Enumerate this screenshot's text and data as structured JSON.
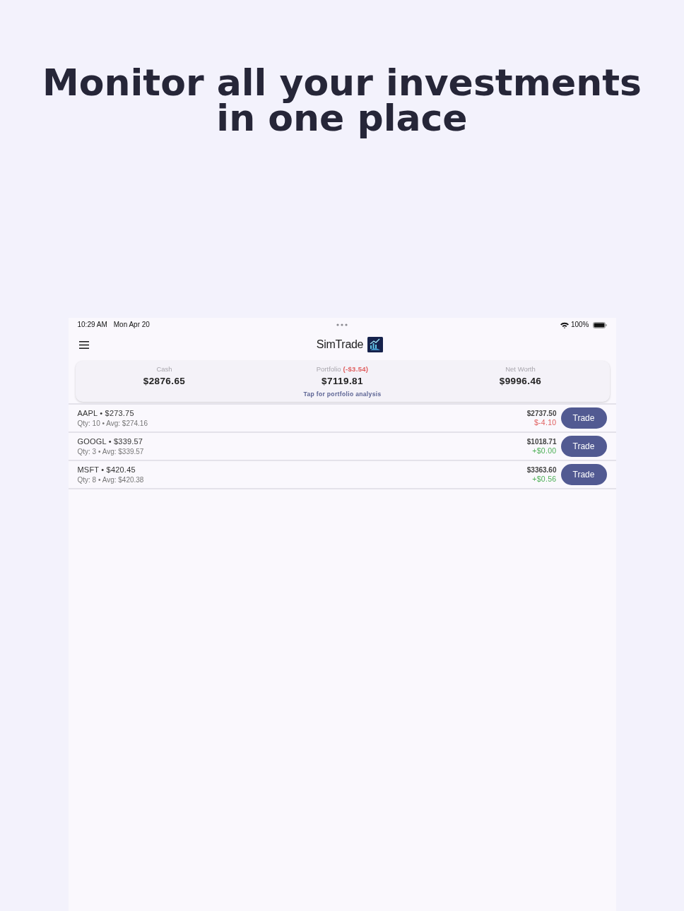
{
  "headline": "Monitor all your investments in one place",
  "status_bar": {
    "time": "10:29 AM",
    "date": "Mon Apr 20",
    "battery": "100%"
  },
  "app_bar": {
    "title": "SimTrade"
  },
  "summary": {
    "items": [
      {
        "label": "Cash",
        "value": "$2876.65"
      },
      {
        "label": "Portfolio",
        "change": "(-$3.54)",
        "color": "#e05d5d",
        "value": "$7119.81"
      },
      {
        "label": "Net Worth",
        "value": "$9996.46"
      }
    ],
    "analysis_link": "Tap for portfolio analysis"
  },
  "holdings": [
    {
      "title": "AAPL • $273.75",
      "detail": "Qty: 10 • Avg: $274.16",
      "value": "$2737.50",
      "change": "$-4.10",
      "color": "#e05d5d",
      "action": "Trade"
    },
    {
      "title": "GOOGL • $339.57",
      "detail": "Qty: 3 • Avg: $339.57",
      "value": "$1018.71",
      "change": "+$0.00",
      "color": "#4caf55",
      "action": "Trade"
    },
    {
      "title": "MSFT • $420.45",
      "detail": "Qty: 8 • Avg: $420.38",
      "value": "$3363.60",
      "change": "+$0.56",
      "color": "#4caf55",
      "action": "Trade"
    }
  ]
}
